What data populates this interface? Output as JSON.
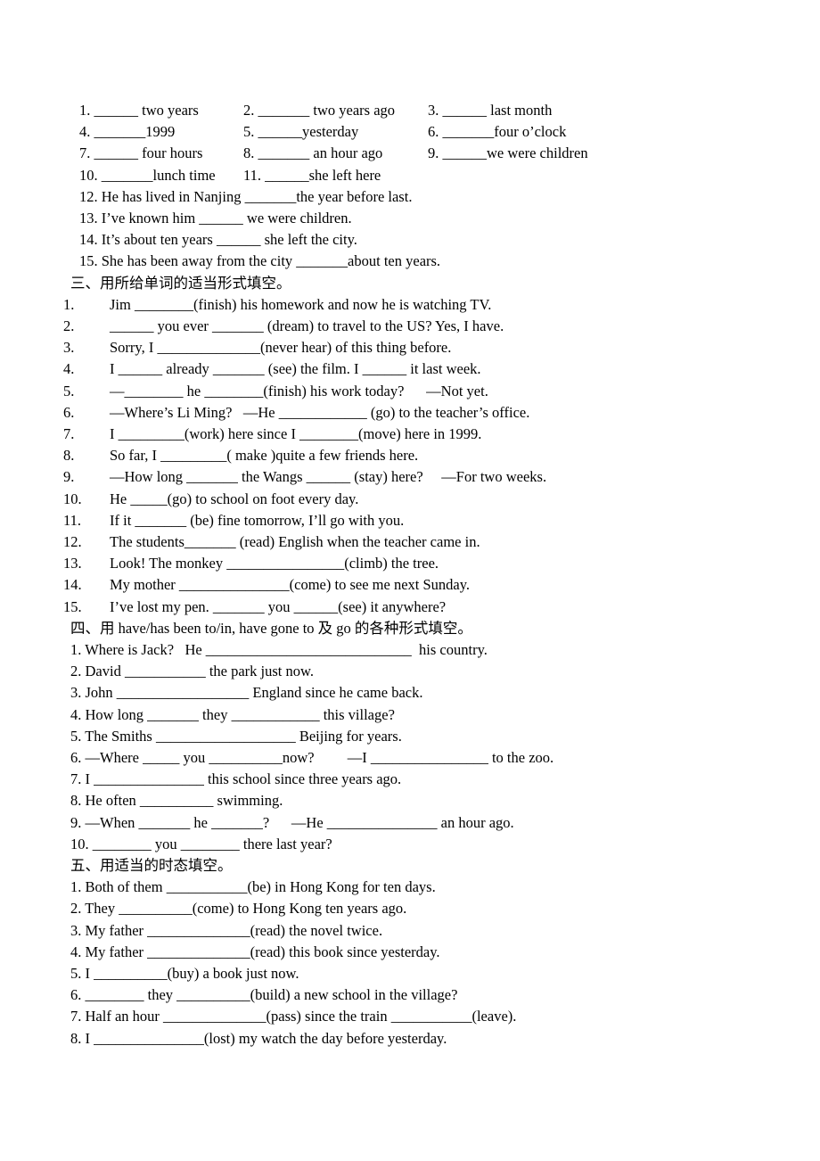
{
  "document": {
    "type": "worksheet",
    "language": "zh-CN + en"
  },
  "section_phrases": {
    "rows": [
      [
        "1. ______ two years",
        "2. _______ two years ago",
        "3. ______ last month"
      ],
      [
        "4. _______1999",
        "5. ______yesterday",
        "6. _______four o’clock"
      ],
      [
        "7. ______ four hours",
        "8. _______ an hour ago",
        "9. ______we were children"
      ],
      [
        "10. _______lunch time",
        "11. ______she left here",
        ""
      ]
    ]
  },
  "section_sentences": {
    "items": [
      "12. He has lived in Nanjing _______the year before last.",
      "13. I’ve known him ______ we were children.",
      "14. It’s about ten years ______ she left the city.",
      "15. She has been away from the city _______about ten years."
    ]
  },
  "section_three": {
    "heading": "三、用所给单词的适当形式填空。",
    "items": [
      {
        "num": "1.",
        "text": "Jim ________(finish) his homework and now he is watching TV."
      },
      {
        "num": "2.",
        "text": "______ you ever _______ (dream) to travel to the US? Yes, I have."
      },
      {
        "num": "3.",
        "text": "Sorry, I ______________(never hear) of this thing before."
      },
      {
        "num": "4.",
        "text": "I ______ already _______ (see) the film. I ______ it last week."
      },
      {
        "num": "5.",
        "text": "—________ he ________(finish) his work today?      —Not yet."
      },
      {
        "num": "6.",
        "text": "—Where’s Li Ming?   —He ____________ (go) to the teacher’s office."
      },
      {
        "num": "7.",
        "text": "I _________(work) here since I ________(move) here in 1999."
      },
      {
        "num": "8.",
        "text": "So far, I _________( make )quite a few friends here."
      },
      {
        "num": "9.",
        "text": "—How long _______ the Wangs ______ (stay) here?     —For two weeks."
      },
      {
        "num": "10.",
        "text": "He _____(go) to school on foot every day."
      },
      {
        "num": "11.",
        "text": "If it _______ (be) fine tomorrow, I’ll go with you."
      },
      {
        "num": "12.",
        "text": "The students_______ (read) English when the teacher came in."
      },
      {
        "num": "13.",
        "text": "Look! The monkey ________________(climb) the tree."
      },
      {
        "num": "14.",
        "text": "My mother _______________(come) to see me next Sunday."
      },
      {
        "num": "15.",
        "text": "I’ve lost my pen. _______ you ______(see) it anywhere?"
      }
    ]
  },
  "section_four": {
    "heading": "四、用 have/has been to/in, have gone to 及 go 的各种形式填空。",
    "items": [
      "1. Where is Jack?   He ____________________________  his country.",
      "2. David ___________ the park just now.",
      "3. John __________________ England since he came back.",
      "4. How long _______ they ____________ this village?",
      "5. The Smiths ___________________ Beijing for years.",
      "6. —Where _____ you __________now?         —I ________________ to the zoo.",
      "7. I _______________ this school since three years ago.",
      "8. He often __________ swimming.",
      "9. —When _______ he _______?      —He _______________ an hour ago.",
      "10. ________ you ________ there last year?"
    ]
  },
  "section_five": {
    "heading": "五、用适当的时态填空。",
    "items": [
      "1. Both of them ___________(be) in Hong Kong for ten days.",
      "2. They __________(come) to Hong Kong ten years ago.",
      "3. My father ______________(read) the novel twice.",
      "4. My father ______________(read) this book since yesterday.",
      "5. I __________(buy) a book just now.",
      "6. ________ they __________(build) a new school in the village?",
      "7. Half an hour ______________(pass) since the train ___________(leave).",
      "8. I _______________(lost) my watch the day before yesterday."
    ]
  }
}
